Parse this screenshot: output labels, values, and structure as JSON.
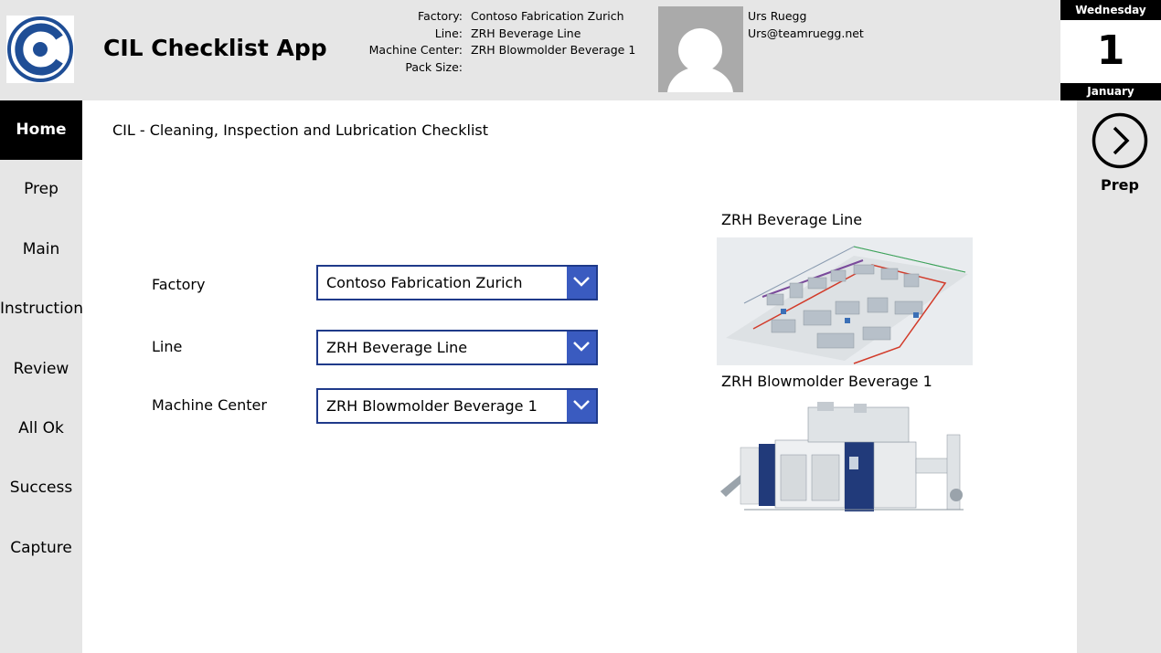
{
  "header": {
    "app_title": "CIL Checklist App",
    "info_labels": {
      "factory": "Factory:",
      "line": "Line:",
      "machine_center": "Machine Center:",
      "pack_size": "Pack Size:"
    },
    "info_values": {
      "factory": "Contoso Fabrication Zurich",
      "line": "ZRH Beverage Line",
      "machine_center": "ZRH Blowmolder Beverage 1",
      "pack_size": ""
    },
    "user": {
      "name": "Urs Ruegg",
      "email": "Urs@teamruegg.net"
    },
    "date": {
      "weekday": "Wednesday",
      "day": "1",
      "month": "January"
    }
  },
  "sidebar": {
    "items": [
      {
        "label": "Home",
        "active": true
      },
      {
        "label": "Prep"
      },
      {
        "label": "Main"
      },
      {
        "label": "Instruction"
      },
      {
        "label": "Review"
      },
      {
        "label": "All Ok"
      },
      {
        "label": "Success"
      },
      {
        "label": "Capture"
      }
    ]
  },
  "main": {
    "page_title": "CIL - Cleaning, Inspection and Lubrication Checklist",
    "fields": [
      {
        "label": "Factory",
        "value": "Contoso Fabrication Zurich"
      },
      {
        "label": "Line",
        "value": "ZRH Beverage Line"
      },
      {
        "label": "Machine Center",
        "value": "ZRH Blowmolder Beverage 1"
      }
    ],
    "line_image_title": "ZRH Beverage Line",
    "machine_image_title": "ZRH Blowmolder Beverage 1"
  },
  "next": {
    "label": "Prep"
  },
  "colors": {
    "accent": "#3a5bc0",
    "border": "#1f3a8a",
    "panel": "#e6e6e6",
    "active_nav": "#000000"
  }
}
